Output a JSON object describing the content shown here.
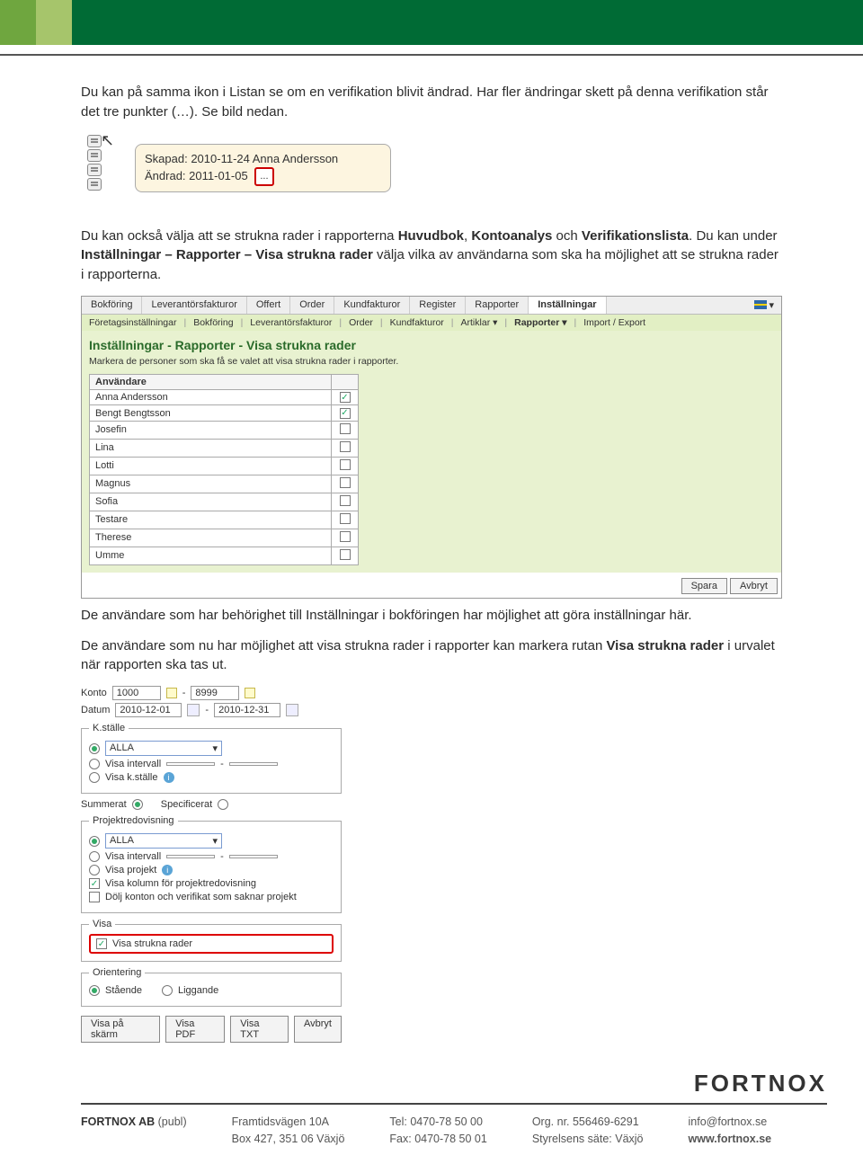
{
  "paragraphs": {
    "p1_a": "Du kan på samma ikon i Listan se om en verifikation blivit ändrad. Har fler ändringar skett på denna verifikation står det tre punkter (…). Se bild nedan.",
    "p2_pre": "Du kan också välja att se strukna rader i rapporterna ",
    "p2_bold1": "Huvudbok",
    "p2_mid1": ", ",
    "p2_bold2": "Kontoanalys",
    "p2_mid2": " och ",
    "p2_bold3": "Verifikationslista",
    "p2_mid3": ". Du kan under ",
    "p2_bold4": "Inställningar – Rapporter – Visa strukna rader",
    "p2_post": " välja vilka av användarna som ska ha möjlighet att se strukna rader i rapporterna.",
    "p3": "De användare som har behörighet till Inställningar i bokföringen har möjlighet att göra inställningar här.",
    "p4_pre": "De användare som nu har möjlighet att visa strukna rader i rapporter kan markera rutan ",
    "p4_bold": "Visa strukna rader",
    "p4_post": " i urvalet när rapporten ska tas ut."
  },
  "tooltip": {
    "skapad_label": "Skapad:",
    "skapad_val": "2010-11-24 Anna Andersson",
    "andrad_label": "Ändrad:",
    "andrad_val": "2011-01-05",
    "ellipsis": "..."
  },
  "shot1": {
    "tabs_main": [
      "Bokföring",
      "Leverantörsfakturor",
      "Offert",
      "Order",
      "Kundfakturor",
      "Register",
      "Rapporter",
      "Inställningar"
    ],
    "tabs_sub": [
      "Företagsinställningar",
      "Bokföring",
      "Leverantörsfakturor",
      "Order",
      "Kundfakturor",
      "Artiklar ▾",
      "Rapporter ▾",
      "Import / Export"
    ],
    "title": "Inställningar - Rapporter - Visa strukna rader",
    "subtitle": "Markera de personer som ska få se valet att visa strukna rader i rapporter.",
    "th": "Användare",
    "users": [
      {
        "name": "Anna Andersson",
        "checked": "✓"
      },
      {
        "name": "Bengt Bengtsson",
        "checked": "✓"
      },
      {
        "name": "Josefin",
        "checked": ""
      },
      {
        "name": "Lina",
        "checked": ""
      },
      {
        "name": "Lotti",
        "checked": ""
      },
      {
        "name": "Magnus",
        "checked": ""
      },
      {
        "name": "Sofia",
        "checked": ""
      },
      {
        "name": "Testare",
        "checked": ""
      },
      {
        "name": "Therese",
        "checked": ""
      },
      {
        "name": "Umme",
        "checked": ""
      }
    ],
    "btn_save": "Spara",
    "btn_cancel": "Avbryt"
  },
  "shot2": {
    "konto_label": "Konto",
    "konto_from": "1000",
    "konto_to": "8999",
    "datum_label": "Datum",
    "datum_from": "2010-12-01",
    "datum_to": "2010-12-31",
    "k_stalle": "K.ställe",
    "alla": "ALLA",
    "visa_intervall": "Visa intervall",
    "visa_kstalle": "Visa k.ställe",
    "summerat": "Summerat",
    "specificerat": "Specificerat",
    "projekt_legend": "Projektredovisning",
    "visa_projekt": "Visa projekt",
    "visa_kolumn": "Visa kolumn för projektredovisning",
    "dolj_konton": "Dölj konton och verifikat som saknar projekt",
    "visa_legend": "Visa",
    "visa_strukna": "Visa strukna rader",
    "orient_legend": "Orientering",
    "staende": "Stående",
    "liggande": "Liggande",
    "btn_skarm": "Visa på skärm",
    "btn_pdf": "Visa PDF",
    "btn_txt": "Visa TXT",
    "btn_avbryt": "Avbryt"
  },
  "footer": {
    "logo": "FORTNOX",
    "company": "FORTNOX AB",
    "publ": " (publ)",
    "addr1": "Framtidsvägen 10A",
    "addr2": "Box 427, 351 06 Växjö",
    "tel": "Tel: 0470-78 50 00",
    "fax": "Fax: 0470-78 50 01",
    "org": "Org. nr. 556469-6291",
    "sate": "Styrelsens säte: Växjö",
    "email": "info@fortnox.se",
    "web": "www.fortnox.se"
  }
}
